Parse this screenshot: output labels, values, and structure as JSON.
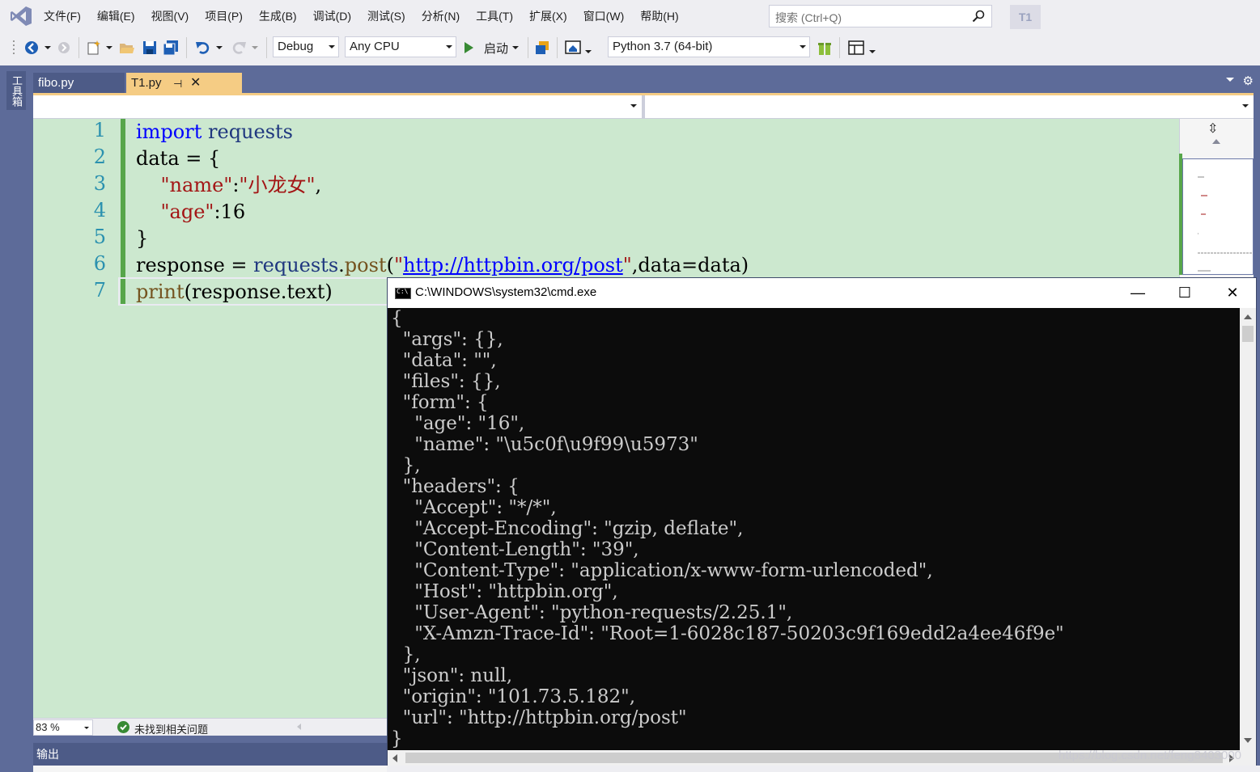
{
  "menu": {
    "items": [
      "文件(F)",
      "编辑(E)",
      "视图(V)",
      "项目(P)",
      "生成(B)",
      "调试(D)",
      "测试(S)",
      "分析(N)",
      "工具(T)",
      "扩展(X)",
      "窗口(W)",
      "帮助(H)"
    ],
    "search_placeholder": "搜索 (Ctrl+Q)",
    "profile": "T1"
  },
  "toolbar": {
    "config": "Debug",
    "platform": "Any CPU",
    "start_label": "启动",
    "environment": "Python 3.7 (64-bit)"
  },
  "toolbox": {
    "label": "工具箱"
  },
  "tabs": [
    {
      "label": "fibo.py",
      "active": false
    },
    {
      "label": "T1.py",
      "active": true,
      "pin": "⊣",
      "close": "✕"
    }
  ],
  "editor": {
    "line_numbers": [
      "1",
      "2",
      "3",
      "4",
      "5",
      "6",
      "7"
    ],
    "code": {
      "l1": {
        "kw": "import",
        "mod": "requests"
      },
      "l2": {
        "ident": "data",
        "rest": " = {"
      },
      "l3": {
        "key": "\"name\"",
        "sep": ":",
        "val": "\"小龙女\"",
        "end": ","
      },
      "l4": {
        "key": "\"age\"",
        "sep": ":16"
      },
      "l5": {
        "text": "}"
      },
      "l6": {
        "ident": "response",
        "eq": " = ",
        "mod": "requests",
        "dot": ".",
        "fn": "post",
        "open": "(",
        "q1": "\"",
        "url": "http://httpbin.org/post",
        "q2": "\"",
        "rest": ",data=data)"
      },
      "l7": {
        "fn": "print",
        "rest": "(response.text)"
      }
    }
  },
  "status": {
    "zoom": "83 %",
    "issues": "未找到相关问题"
  },
  "output": {
    "title": "输出"
  },
  "cmd": {
    "title": "C:\\WINDOWS\\system32\\cmd.exe",
    "lines": [
      "{",
      "  \"args\": {},",
      "  \"data\": \"\",",
      "  \"files\": {},",
      "  \"form\": {",
      "    \"age\": \"16\",",
      "    \"name\": \"\\u5c0f\\u9f99\\u5973\"",
      "  },",
      "  \"headers\": {",
      "    \"Accept\": \"*/*\",",
      "    \"Accept-Encoding\": \"gzip, deflate\",",
      "    \"Content-Length\": \"39\",",
      "    \"Content-Type\": \"application/x-www-form-urlencoded\",",
      "    \"Host\": \"httpbin.org\",",
      "    \"User-Agent\": \"python-requests/2.25.1\",",
      "    \"X-Amzn-Trace-Id\": \"Root=1-6028c187-50203c9f169edd2a4ee46f9e\"",
      "  },",
      "  \"json\": null,",
      "  \"origin\": \"101.73.5.182\",",
      "  \"url\": \"http://httpbin.org/post\"",
      "}"
    ],
    "buttons": {
      "minimize": "—",
      "maximize": "☐",
      "close": "✕"
    }
  },
  "watermark": "https://blog.csdn.net/feng8403000",
  "colors": {
    "editor_bg": "#cce8cf",
    "accent_tab": "#f5cc84",
    "chrome": "#5d6b99",
    "console_bg": "#0c0c0c"
  }
}
